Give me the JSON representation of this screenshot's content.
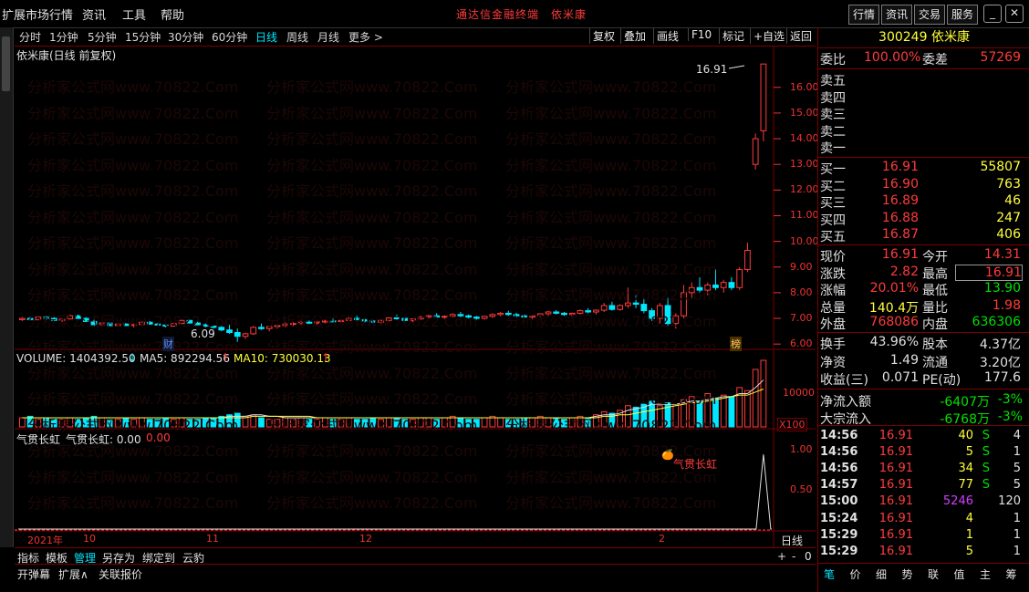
{
  "menu": {
    "items": [
      "扩展市场行情",
      "资讯",
      "工具",
      "帮助"
    ],
    "title": "通达信金融终端　依米康",
    "right_buttons": [
      "行情",
      "资讯",
      "交易",
      "服务"
    ]
  },
  "periods": {
    "items": [
      "分时",
      "1分钟",
      "5分钟",
      "15分钟",
      "30分钟",
      "60分钟",
      "日线",
      "周线",
      "月线",
      "更多 >"
    ],
    "active_index": 6,
    "tools": [
      "复权",
      "叠加",
      "画线",
      "F10",
      "标记",
      "+自选",
      "返回"
    ]
  },
  "main_panel": {
    "title": "依米康(日线 前复权)",
    "high_annotation": "16.91",
    "low_annotation": "6.09",
    "cai_tag": "财",
    "bang_tag": "榜",
    "y_ticks": [
      "16.00",
      "15.00",
      "14.00",
      "13.00",
      "12.00",
      "11.00",
      "10.00",
      "9.00",
      "8.00",
      "7.00",
      "6.00"
    ]
  },
  "volume_panel": {
    "volume_label": "VOLUME: 1404392.50",
    "ma5_label": "MA5: 892294.56",
    "ma10_label": "MA10: 730030.13",
    "tick": "10000",
    "unit": "X100"
  },
  "indicator_panel": {
    "title": "气贯长虹",
    "value_label": "气贯长虹: 0.00",
    "value_red": "0.00",
    "signal_text": "气贯长虹",
    "ticks": [
      "1.00",
      "0.50"
    ]
  },
  "time_axis": {
    "labels": [
      "2021年",
      "10",
      "11",
      "12",
      "2"
    ],
    "period_tag": "日线"
  },
  "bottom_tabs": {
    "row1": [
      "指标",
      "模板",
      "管理",
      "另存为",
      "绑定到",
      "云豹"
    ],
    "active_index": 2,
    "row2": [
      "开弹幕",
      "扩展∧",
      "关联报价"
    ],
    "controls": [
      "+",
      "-",
      "0"
    ]
  },
  "quote": {
    "code_name": "300249 依米康",
    "weibi_label": "委比",
    "weibi_value": "100.00%",
    "weicha_label": "委差",
    "weicha_value": "57269",
    "sell": [
      {
        "label": "卖五"
      },
      {
        "label": "卖四"
      },
      {
        "label": "卖三"
      },
      {
        "label": "卖二"
      },
      {
        "label": "卖一"
      }
    ],
    "buy": [
      {
        "label": "买一",
        "price": "16.91",
        "vol": "55807"
      },
      {
        "label": "买二",
        "price": "16.90",
        "vol": "763"
      },
      {
        "label": "买三",
        "price": "16.89",
        "vol": "46"
      },
      {
        "label": "买四",
        "price": "16.88",
        "vol": "247"
      },
      {
        "label": "买五",
        "price": "16.87",
        "vol": "406"
      }
    ],
    "stats": [
      {
        "l1": "现价",
        "v1": "16.91",
        "l2": "今开",
        "v2": "14.31"
      },
      {
        "l1": "涨跌",
        "v1": "2.82",
        "l2": "最高",
        "v2": "16.91"
      },
      {
        "l1": "涨幅",
        "v1": "20.01%",
        "l2": "最低",
        "v2": "13.90"
      },
      {
        "l1": "总量",
        "v1": "140.4万",
        "l2": "量比",
        "v2": "1.98"
      },
      {
        "l1": "外盘",
        "v1": "768086",
        "l2": "内盘",
        "v2": "636306"
      }
    ],
    "stats2": [
      {
        "l1": "换手",
        "v1": "43.96%",
        "l2": "股本",
        "v2": "4.37亿"
      },
      {
        "l1": "净资",
        "v1": "1.49",
        "l2": "流通",
        "v2": "3.20亿"
      },
      {
        "l1": "收益(三)",
        "v1": "0.071",
        "l2": "PE(动)",
        "v2": "177.6"
      }
    ],
    "flows": [
      {
        "label": "净流入额",
        "value": "-6407万",
        "pct": "-3%"
      },
      {
        "label": "大宗流入",
        "value": "-6768万",
        "pct": "-3%"
      }
    ],
    "ticks": [
      {
        "time": "14:56",
        "price": "16.91",
        "vol": "40",
        "side": "S",
        "count": "4"
      },
      {
        "time": "14:56",
        "price": "16.91",
        "vol": "5",
        "side": "S",
        "count": "1"
      },
      {
        "time": "14:56",
        "price": "16.91",
        "vol": "34",
        "side": "S",
        "count": "5"
      },
      {
        "time": "14:57",
        "price": "16.91",
        "vol": "77",
        "side": "S",
        "count": "5"
      },
      {
        "time": "15:00",
        "price": "16.91",
        "vol": "5246",
        "side": "",
        "count": "120"
      },
      {
        "time": "15:24",
        "price": "16.91",
        "vol": "4",
        "side": "",
        "count": "1"
      },
      {
        "time": "15:29",
        "price": "16.91",
        "vol": "1",
        "side": "",
        "count": "1"
      },
      {
        "time": "15:29",
        "price": "16.91",
        "vol": "5",
        "side": "",
        "count": "1"
      }
    ],
    "bottom_tabs": [
      "笔",
      "价",
      "细",
      "势",
      "联",
      "值",
      "主",
      "筹"
    ]
  },
  "watermark": "分析家公式网www.70822.Com",
  "colors": {
    "up": "#ff3b3b",
    "down": "#00e8ff",
    "ma": "#e0e0e0",
    "bg": "#000000",
    "frame": "#7a0000"
  },
  "chart_data": {
    "type": "candlestick",
    "title": "依米康(日线 前复权)",
    "ylim": [
      5.9,
      17.2
    ],
    "candles": [
      [
        6.95,
        7.05,
        6.9,
        7.0
      ],
      [
        7.0,
        7.05,
        6.92,
        6.95
      ],
      [
        6.95,
        7.1,
        6.9,
        7.05
      ],
      [
        7.05,
        7.1,
        6.95,
        7.0
      ],
      [
        7.0,
        7.05,
        6.9,
        6.92
      ],
      [
        6.92,
        7.0,
        6.85,
        6.98
      ],
      [
        6.98,
        7.15,
        6.95,
        7.1
      ],
      [
        7.1,
        7.15,
        6.98,
        7.0
      ],
      [
        7.0,
        7.05,
        6.85,
        6.88
      ],
      [
        6.88,
        6.95,
        6.7,
        6.75
      ],
      [
        6.75,
        6.85,
        6.7,
        6.82
      ],
      [
        6.82,
        6.85,
        6.7,
        6.72
      ],
      [
        6.72,
        6.8,
        6.68,
        6.78
      ],
      [
        6.78,
        6.82,
        6.7,
        6.72
      ],
      [
        6.72,
        6.8,
        6.65,
        6.76
      ],
      [
        6.76,
        6.88,
        6.72,
        6.85
      ],
      [
        6.85,
        6.9,
        6.75,
        6.78
      ],
      [
        6.78,
        6.82,
        6.7,
        6.74
      ],
      [
        6.74,
        6.78,
        6.65,
        6.7
      ],
      [
        6.7,
        6.82,
        6.68,
        6.8
      ],
      [
        6.8,
        6.95,
        6.78,
        6.92
      ],
      [
        6.92,
        6.95,
        6.8,
        6.82
      ],
      [
        6.82,
        6.88,
        6.72,
        6.75
      ],
      [
        6.75,
        6.8,
        6.65,
        6.7
      ],
      [
        6.7,
        6.75,
        6.6,
        6.65
      ],
      [
        6.65,
        6.7,
        6.5,
        6.55
      ],
      [
        6.55,
        6.75,
        6.4,
        6.45
      ],
      [
        6.45,
        6.6,
        6.09,
        6.3
      ],
      [
        6.3,
        6.45,
        6.2,
        6.4
      ],
      [
        6.4,
        6.7,
        6.35,
        6.65
      ],
      [
        6.65,
        6.8,
        6.55,
        6.6
      ],
      [
        6.6,
        6.7,
        6.5,
        6.68
      ],
      [
        6.68,
        6.75,
        6.6,
        6.72
      ],
      [
        6.72,
        6.85,
        6.65,
        6.78
      ],
      [
        6.78,
        6.85,
        6.7,
        6.8
      ],
      [
        6.8,
        6.9,
        6.72,
        6.85
      ],
      [
        6.85,
        6.92,
        6.78,
        6.82
      ],
      [
        6.82,
        6.88,
        6.75,
        6.86
      ],
      [
        6.86,
        6.95,
        6.8,
        6.9
      ],
      [
        6.9,
        7.0,
        6.85,
        6.88
      ],
      [
        6.88,
        6.95,
        6.8,
        6.92
      ],
      [
        6.92,
        7.05,
        6.88,
        7.0
      ],
      [
        7.0,
        7.1,
        6.92,
        6.95
      ],
      [
        6.95,
        7.0,
        6.85,
        6.9
      ],
      [
        6.9,
        6.95,
        6.82,
        6.85
      ],
      [
        6.85,
        6.95,
        6.8,
        6.92
      ],
      [
        6.92,
        7.05,
        6.88,
        7.02
      ],
      [
        7.02,
        7.15,
        6.95,
        7.0
      ],
      [
        7.0,
        7.05,
        6.9,
        6.92
      ],
      [
        6.92,
        7.0,
        6.85,
        6.98
      ],
      [
        6.98,
        7.1,
        6.95,
        7.05
      ],
      [
        7.05,
        7.15,
        7.0,
        7.1
      ],
      [
        7.1,
        7.2,
        7.0,
        7.05
      ],
      [
        7.05,
        7.12,
        6.98,
        7.08
      ],
      [
        7.08,
        7.2,
        7.02,
        7.15
      ],
      [
        7.15,
        7.25,
        7.05,
        7.1
      ],
      [
        7.1,
        7.15,
        7.0,
        7.05
      ],
      [
        7.05,
        7.1,
        6.95,
        7.0
      ],
      [
        7.0,
        7.1,
        6.95,
        7.08
      ],
      [
        7.08,
        7.2,
        7.02,
        7.15
      ],
      [
        7.15,
        7.25,
        7.08,
        7.2
      ],
      [
        7.2,
        7.3,
        7.1,
        7.15
      ],
      [
        7.15,
        7.22,
        7.05,
        7.1
      ],
      [
        7.1,
        7.15,
        7.0,
        7.05
      ],
      [
        7.05,
        7.12,
        6.98,
        7.1
      ],
      [
        7.1,
        7.2,
        7.05,
        7.18
      ],
      [
        7.18,
        7.3,
        7.1,
        7.25
      ],
      [
        7.25,
        7.32,
        7.15,
        7.2
      ],
      [
        7.2,
        7.25,
        7.1,
        7.15
      ],
      [
        7.15,
        7.22,
        7.08,
        7.2
      ],
      [
        7.2,
        7.35,
        7.15,
        7.3
      ],
      [
        7.3,
        7.4,
        7.2,
        7.25
      ],
      [
        7.25,
        7.35,
        7.15,
        7.32
      ],
      [
        7.32,
        7.6,
        7.25,
        7.5
      ],
      [
        7.5,
        7.65,
        7.3,
        7.35
      ],
      [
        7.35,
        7.55,
        7.3,
        7.5
      ],
      [
        7.5,
        8.2,
        7.4,
        7.6
      ],
      [
        7.6,
        7.9,
        7.4,
        7.55
      ],
      [
        7.55,
        7.8,
        7.2,
        7.3
      ],
      [
        7.3,
        7.4,
        6.9,
        7.0
      ],
      [
        7.0,
        7.6,
        6.8,
        7.5
      ],
      [
        7.5,
        7.8,
        6.7,
        6.8
      ],
      [
        6.8,
        7.2,
        6.6,
        7.1
      ],
      [
        7.1,
        8.3,
        7.0,
        8.0
      ],
      [
        8.0,
        8.4,
        7.8,
        8.2
      ],
      [
        8.2,
        8.6,
        8.0,
        8.1
      ],
      [
        8.1,
        8.4,
        7.9,
        8.3
      ],
      [
        8.3,
        8.9,
        8.1,
        8.2
      ],
      [
        8.2,
        8.5,
        8.0,
        8.4
      ],
      [
        8.4,
        8.6,
        8.1,
        8.2
      ],
      [
        8.2,
        9.0,
        8.1,
        8.9
      ],
      [
        8.9,
        9.95,
        8.8,
        9.65
      ],
      [
        13.0,
        14.2,
        12.8,
        14.0
      ],
      [
        14.31,
        16.91,
        13.9,
        16.91
      ]
    ],
    "volume": [
      6,
      7,
      5,
      6,
      5,
      5,
      6,
      5,
      6,
      7,
      6,
      5,
      5,
      6,
      5,
      6,
      5,
      5,
      6,
      5,
      6,
      5,
      5,
      6,
      6,
      7,
      8,
      9,
      7,
      8,
      6,
      5,
      5,
      6,
      5,
      6,
      5,
      5,
      6,
      5,
      5,
      6,
      5,
      5,
      6,
      5,
      6,
      6,
      5,
      5,
      6,
      6,
      5,
      6,
      7,
      6,
      5,
      5,
      6,
      7,
      6,
      5,
      5,
      6,
      6,
      7,
      6,
      6,
      5,
      6,
      7,
      6,
      8,
      10,
      9,
      11,
      14,
      13,
      15,
      17,
      14,
      16,
      15,
      18,
      20,
      17,
      22,
      19,
      21,
      20,
      26,
      24,
      38,
      44
    ],
    "volume_ma5": [
      6,
      6,
      6,
      6,
      6,
      6,
      6,
      6,
      6,
      6,
      6,
      6,
      6,
      6,
      6,
      6,
      6,
      6,
      6,
      6,
      6,
      6,
      6,
      6,
      6,
      6,
      7,
      7,
      7,
      8,
      8,
      7,
      7,
      6,
      6,
      6,
      6,
      6,
      6,
      6,
      6,
      6,
      6,
      6,
      6,
      6,
      6,
      6,
      6,
      6,
      6,
      6,
      6,
      6,
      6,
      6,
      6,
      6,
      6,
      6,
      6,
      6,
      6,
      6,
      6,
      6,
      6,
      6,
      6,
      6,
      6,
      6,
      7,
      8,
      8,
      9,
      11,
      12,
      13,
      15,
      15,
      15,
      15,
      16,
      17,
      17,
      18,
      19,
      20,
      20,
      22,
      22,
      26,
      31
    ],
    "volume_ma10": [
      6,
      6,
      6,
      6,
      6,
      6,
      6,
      6,
      6,
      6,
      6,
      6,
      6,
      6,
      6,
      6,
      6,
      6,
      6,
      6,
      6,
      6,
      6,
      6,
      6,
      6,
      6,
      6,
      6,
      7,
      7,
      7,
      7,
      7,
      7,
      7,
      7,
      6,
      6,
      6,
      6,
      6,
      6,
      6,
      6,
      6,
      6,
      6,
      6,
      6,
      6,
      6,
      6,
      6,
      6,
      6,
      6,
      6,
      6,
      6,
      6,
      6,
      6,
      6,
      6,
      6,
      6,
      6,
      6,
      6,
      6,
      6,
      6,
      7,
      7,
      8,
      8,
      9,
      10,
      11,
      12,
      13,
      14,
      15,
      16,
      16,
      17,
      18,
      19,
      20,
      21,
      21,
      23,
      25
    ],
    "indicator": {
      "signal_index": 93,
      "value": 1.0,
      "ylim": [
        0,
        1.1
      ]
    }
  }
}
